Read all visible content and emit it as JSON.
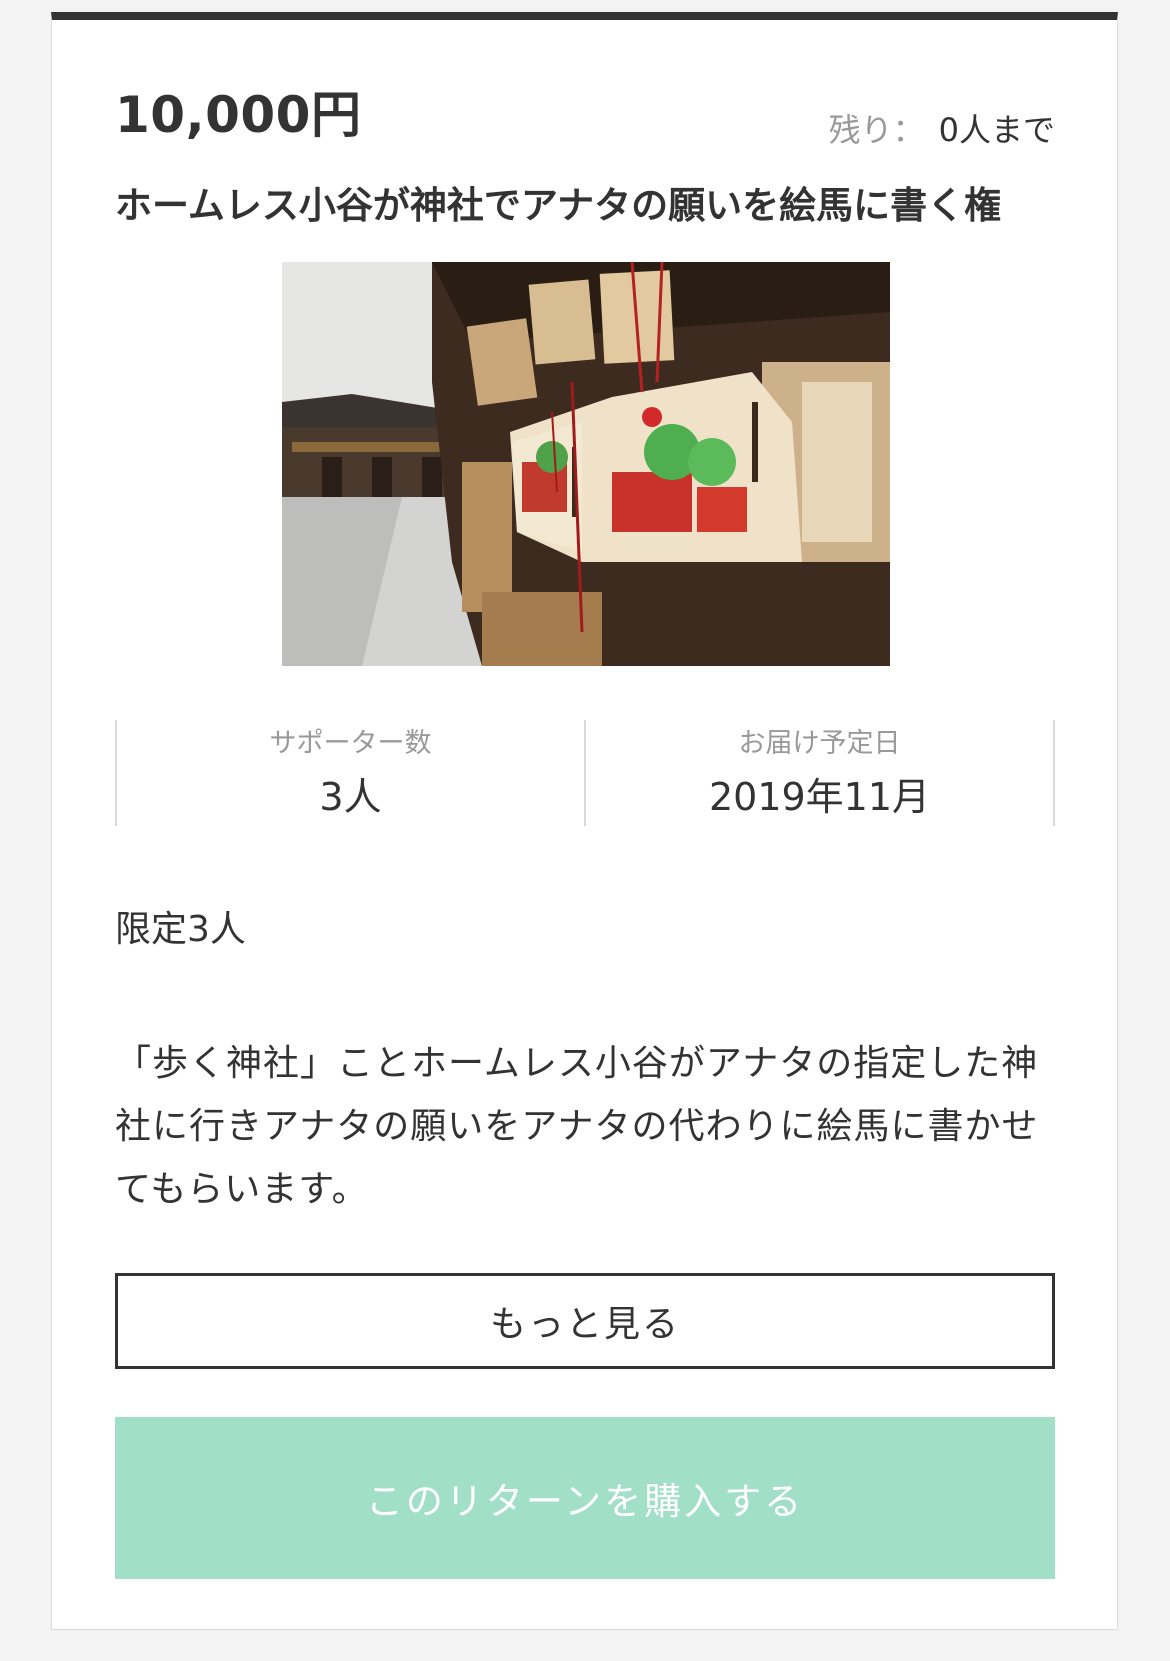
{
  "reward": {
    "price": "10,000円",
    "remaining_label": "残り：",
    "remaining_value": "0人まで",
    "title": "ホームレス小谷が神社でアナタの願いを絵馬に書く権",
    "stats": [
      {
        "label": "サポーター数",
        "value": "3人"
      },
      {
        "label": "お届け予定日",
        "value": "2019年11月"
      }
    ],
    "limit_text": "限定3人",
    "description": "「歩く神社」ことホームレス小谷がアナタの指定した神社に行きアナタの願いをアナタの代わりに絵馬に書かせてもらいます。",
    "more_label": "もっと見る",
    "buy_label": "このリターンを購入する"
  },
  "colors": {
    "accent_top_border": "#333333",
    "buy_button_bg": "#a1dfc9",
    "muted_text": "#999999"
  }
}
